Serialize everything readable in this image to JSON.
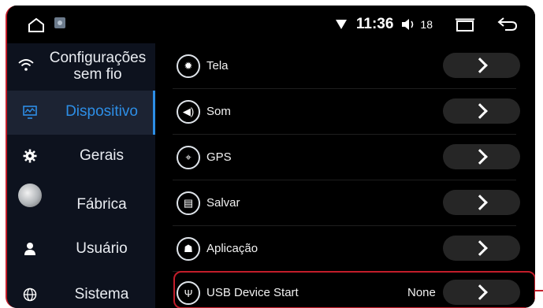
{
  "status_bar": {
    "time": "11:36",
    "volume": "18",
    "icons": [
      "home-icon",
      "app-icon",
      "wifi-icon",
      "volume-icon",
      "recent-apps-icon",
      "back-icon"
    ]
  },
  "sidebar": {
    "items": [
      {
        "label": "Configurações sem fio",
        "icon": "wifi-icon"
      },
      {
        "label": "Dispositivo",
        "icon": "device-icon",
        "active": true
      },
      {
        "label": "Gerais",
        "icon": "gear-icon"
      },
      {
        "label": "Fábrica",
        "icon": "magnifier-icon"
      },
      {
        "label": "Usuário",
        "icon": "user-icon"
      },
      {
        "label": "Sistema",
        "icon": "globe-icon"
      }
    ]
  },
  "main": {
    "rows": [
      {
        "label": "Tela",
        "icon": "brightness-icon"
      },
      {
        "label": "Som",
        "icon": "speaker-icon"
      },
      {
        "label": "GPS",
        "icon": "satellite-icon"
      },
      {
        "label": "Salvar",
        "icon": "save-icon"
      },
      {
        "label": "Aplicação",
        "icon": "android-icon"
      },
      {
        "label": "USB Device Start",
        "icon": "usb-icon",
        "value": "None"
      }
    ]
  },
  "colors": {
    "accent": "#2d8ee6",
    "highlight": "#c21d2a",
    "sidebar_bg": "#0d121e",
    "active_bg": "#1c2333"
  }
}
